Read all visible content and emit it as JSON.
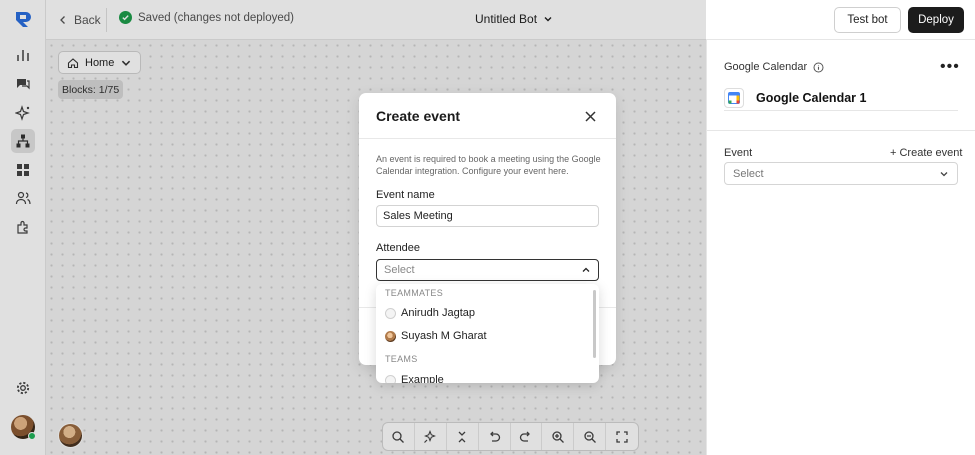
{
  "topbar": {
    "back_label": "Back",
    "saved_status": "Saved (changes not deployed)",
    "bot_name": "Untitled Bot",
    "test_label": "Test bot",
    "deploy_label": "Deploy"
  },
  "sidebar": {
    "items": [
      {
        "icon": "analytics-icon"
      },
      {
        "icon": "chat-icon"
      },
      {
        "icon": "sparkle-icon"
      },
      {
        "icon": "flow-icon",
        "active": true
      },
      {
        "icon": "components-icon"
      },
      {
        "icon": "users-icon"
      },
      {
        "icon": "integrations-icon"
      }
    ],
    "settings_icon": "gear-icon"
  },
  "canvas": {
    "home_label": "Home",
    "blocks_label": "Blocks: 1/75",
    "toolbar_icons": [
      "search-icon",
      "magic-icon",
      "collapse-icon",
      "undo-icon",
      "redo-icon",
      "zoom-in-icon",
      "zoom-out-icon",
      "fullscreen-icon"
    ]
  },
  "panel": {
    "title": "Google Calendar",
    "block_name": "Google Calendar 1",
    "event_label": "Event",
    "create_event": "+ Create event",
    "event_placeholder": "Select"
  },
  "modal": {
    "title": "Create event",
    "description": "An event is required to book a meeting using the Google Calendar integration. Configure your event here.",
    "name_label": "Event name",
    "name_value": "Sales Meeting",
    "attendee_label": "Attendee",
    "attendee_placeholder": "Select"
  },
  "dropdown": {
    "teammates_header": "TEAMMATES",
    "teammates": [
      {
        "name": "Anirudh Jagtap",
        "avatar": "placeholder"
      },
      {
        "name": "Suyash M Gharat",
        "avatar": "photo"
      }
    ],
    "teams_header": "TEAMS",
    "teams": [
      {
        "name": "Example"
      }
    ]
  },
  "colors": {
    "accent": "#1c1c1c",
    "success": "#1e9e4c",
    "logo_blue": "#2b6fe0"
  }
}
